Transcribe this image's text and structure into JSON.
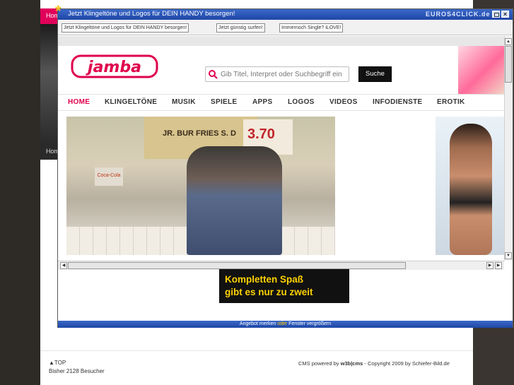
{
  "background_site": {
    "nav_home_label": "Hom",
    "nav_home2_label": "Home",
    "footer": {
      "top_link": "▲TOP",
      "visitors": "Bisher 2128 Besucher",
      "cms_prefix": "CMS powered by ",
      "cms_brand": "w3b|cms",
      "cms_suffix": " - Copyright 2009 by Schiefer-Bild.de"
    }
  },
  "popup": {
    "title": "Jetzt Klingeltöne und Logos für DEIN HANDY besorgen!",
    "brand": "EUROS4CLICK.de",
    "link_buttons": [
      "Jetzt Klingeltöne und Logos für DEIN HANDY besorgen!",
      "Jetzt günstig surfen!",
      "Immernoch Single? iLOVE!"
    ],
    "statusbar": {
      "part1": "Angebot merken ",
      "part2": "oder",
      "part3": " Fenster vergrößern"
    }
  },
  "jamba": {
    "logo_text": "jamba",
    "search": {
      "placeholder": "Gib Titel, Interpret oder Suchbegriff ein",
      "button_label": "Suche"
    },
    "nav": [
      "HOME",
      "KLINGELTÖNE",
      "MUSIK",
      "SPIELE",
      "APPS",
      "LOGOS",
      "VIDEOS",
      "INFODIENSTE",
      "EROTIK"
    ],
    "hero_sign": "JR. BUR FRIES S. D",
    "hero_price": "3.70",
    "hero_coke": "Coca-Cola"
  },
  "promo": {
    "line1": "Kompletten Spaß",
    "line2": "gibt es nur zu zweit"
  },
  "colors": {
    "accent": "#e0004d",
    "titlebar": "#1f47a6",
    "promo_text": "#ffd200"
  }
}
